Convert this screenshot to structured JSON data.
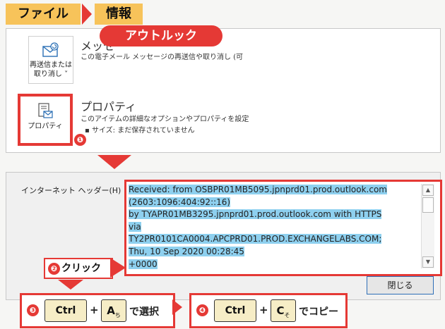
{
  "breadcrumb": {
    "item1": "ファイル",
    "item2": "情報"
  },
  "badge": {
    "outlook": "アウトルック"
  },
  "info": {
    "resend": {
      "button_line1": "再送信または",
      "button_line2": "取り消し ˅",
      "title": "メッセ",
      "description": "この電子メール メッセージの再送信や取り消し (可"
    },
    "properties": {
      "button_label": "プロパティ",
      "title": "プロパティ",
      "description": "このアイテムの詳細なオプションやプロパティを設定",
      "size_bullet": "▪   サイズ:  まだ保存されていません"
    }
  },
  "steps": {
    "step1": "❶",
    "step2": "❷",
    "step2_label": "クリック",
    "step3": "❸",
    "step4": "❹"
  },
  "dialog": {
    "header_label": "インターネット ヘッダー(H)",
    "header_lines": [
      "Received: from OSBPR01MB5095.jpnprd01.prod.outlook.com",
      "(2603:1096:404:92::16)",
      " by TYAPR01MB3295.jpnprd01.prod.outlook.com with HTTPS",
      "via",
      " TY2PR0101CA0004.APCPRD01.PROD.EXCHANGELABS.COM;",
      "Thu, 10 Sep 2020 00:28:45",
      " +0000"
    ],
    "close_button": "閉じる"
  },
  "instructions": {
    "select": {
      "key1": "Ctrl",
      "plus": "+",
      "key2_main": "A",
      "key2_sub": "ち",
      "text": "で選択"
    },
    "copy": {
      "key1": "Ctrl",
      "plus": "+",
      "key2_main": "C",
      "key2_sub": "そ",
      "text": "でコピー"
    }
  },
  "colors": {
    "accent": "#e53935",
    "crumb": "#f7c35a",
    "highlight": "#8ed0ef",
    "key": "#f6edc6"
  }
}
